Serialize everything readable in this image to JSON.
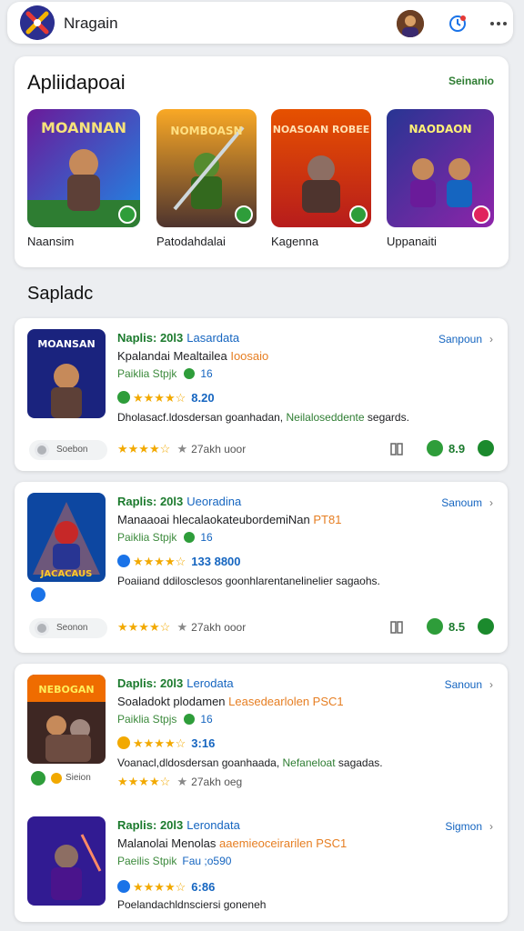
{
  "header": {
    "app_name": "Nragain",
    "logo_icon": "crossed-swords-logo-icon",
    "avatar": "user-avatar",
    "actions": [
      "notification-bell-icon",
      "more-options-icon"
    ]
  },
  "featured": {
    "title": "Apliidapoai",
    "link": "Seinanio",
    "items": [
      {
        "label": "Naansim",
        "art_title": "MOANNAN",
        "badge_color": "#2e9d3a"
      },
      {
        "label": "Patodahdalai",
        "art_title": "NOMBOASN",
        "badge_color": "#2e9d3a"
      },
      {
        "label": "Kagenna",
        "art_title": "NOASOAN ROBEE",
        "badge_color": "#2e9d3a"
      },
      {
        "label": "Uppanaiti",
        "art_title": "NAODAON",
        "badge_color": "#e0245e"
      }
    ]
  },
  "section": {
    "title": "Sapladc"
  },
  "cards": [
    {
      "thumb_title": "MOANSAN",
      "title": "Naplis: 20l3",
      "tag": "Lasardata",
      "subtitle": "Kpalandai Mealtailea",
      "subtitle_accent": "Ioosaio",
      "meta": "Paiklia Stpjk",
      "meta_val": "16",
      "rating": "★★★★☆",
      "rating_num": "8.20",
      "desc": "Dholasacf.ldosdersan goanhadan,",
      "desc_green": "Neilaloseddente",
      "desc_end": "segards.",
      "action": "Sanpoun",
      "pill": "Soebon",
      "bottom_stars": "★★★★☆",
      "bottom_text": "27akh uoor",
      "score": "8.9"
    },
    {
      "thumb_title": "JACACAUS",
      "title": "Raplis: 20l3",
      "tag": "Ueoradina",
      "subtitle": "Manaaoai hlecalaokateubordemiNan",
      "subtitle_accent": "PT81",
      "meta": "Paiklia Stpjk",
      "meta_val": "16",
      "rating": "★★★★☆",
      "rating_num": "133 8800",
      "desc": "Poaiiand ddilosclesos goonhlarentanelinelier sagaohs.",
      "desc_green": "",
      "desc_end": "",
      "action": "Sanoum",
      "pill": "Seonon",
      "bottom_stars": "★★★★☆",
      "bottom_text": "27akh ooor",
      "score": "8.5"
    },
    {
      "thumb_title": "NEBOGAN",
      "title": "Daplis: 20l3",
      "tag": "Lerodata",
      "subtitle": "Soaladokt plodamen",
      "subtitle_accent": "Leasedearlolen PSC1",
      "meta": "Paiklia Stpjs",
      "meta_val": "16",
      "rating": "★★★★☆",
      "rating_num": "3:16",
      "desc": "Voanacl,dldosdersan goanhaada,",
      "desc_green": "Nefaneloat",
      "desc_end": "sagadas.",
      "action": "Sanoun",
      "pill": "Sieion",
      "bottom_stars": "★★★★☆",
      "bottom_text": "27akh oeg",
      "score": ""
    },
    {
      "thumb_title": "",
      "title": "Raplis: 20l3",
      "tag": "Lerondata",
      "subtitle": "Malanolai Menolas",
      "subtitle_accent": "aaemieoceirarilen PSC1",
      "meta": "Paeilis Stpik",
      "meta_val": "Fau ;o590",
      "rating": "★★★★☆",
      "rating_num": "6:86",
      "desc": "Poelandachldnsciersi goneneh",
      "desc_green": "",
      "desc_end": "",
      "action": "Sigmon",
      "pill": "",
      "bottom_stars": "",
      "bottom_text": "",
      "score": ""
    }
  ],
  "colors": {
    "green": "#1b7a2d",
    "blue": "#1565c0",
    "star": "#f2a900"
  }
}
